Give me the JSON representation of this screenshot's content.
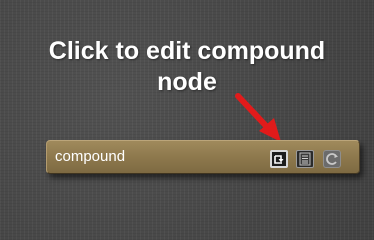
{
  "caption": {
    "text": "Click to edit compound\nnode"
  },
  "node": {
    "label": "compound"
  },
  "colors": {
    "background": "#4a4a4a",
    "node_fill": "#8f7a4e",
    "arrow": "#e11b1b",
    "caption_text": "#ffffff"
  },
  "icons": {
    "pointer_arrow": "red-arrow-icon",
    "edit_button": "edit-compound-icon",
    "list_button": "list-icon",
    "cycle_button": "cycle-icon"
  }
}
